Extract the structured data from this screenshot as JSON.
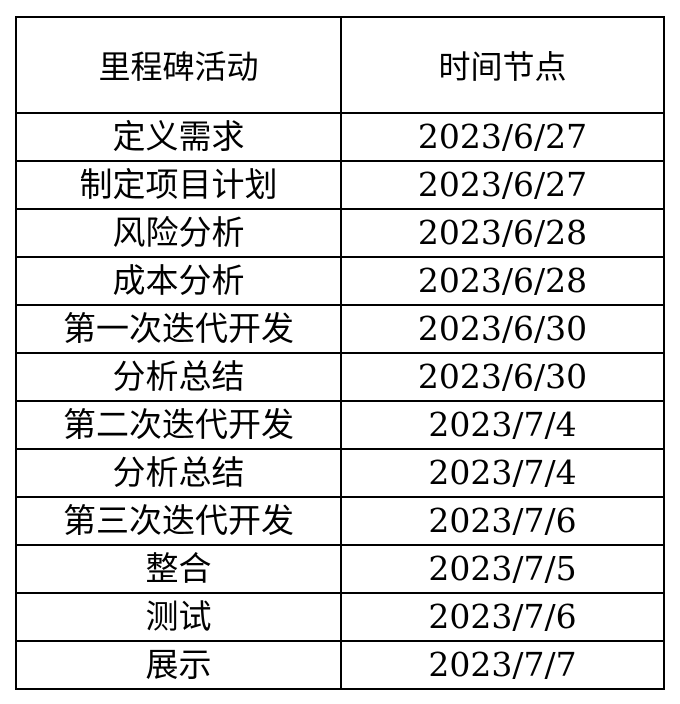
{
  "table": {
    "headers": [
      "里程碑活动",
      "时间节点"
    ],
    "rows": [
      [
        "定义需求",
        "2023/6/27"
      ],
      [
        "制定项目计划",
        "2023/6/27"
      ],
      [
        "风险分析",
        "2023/6/28"
      ],
      [
        "成本分析",
        "2023/6/28"
      ],
      [
        "第一次迭代开发",
        "2023/6/30"
      ],
      [
        "分析总结",
        "2023/6/30"
      ],
      [
        "第二次迭代开发",
        "2023/7/4"
      ],
      [
        "分析总结",
        "2023/7/4"
      ],
      [
        "第三次迭代开发",
        "2023/7/6"
      ],
      [
        "整合",
        "2023/7/5"
      ],
      [
        "测试",
        "2023/7/6"
      ],
      [
        "展示",
        "2023/7/7"
      ]
    ]
  }
}
